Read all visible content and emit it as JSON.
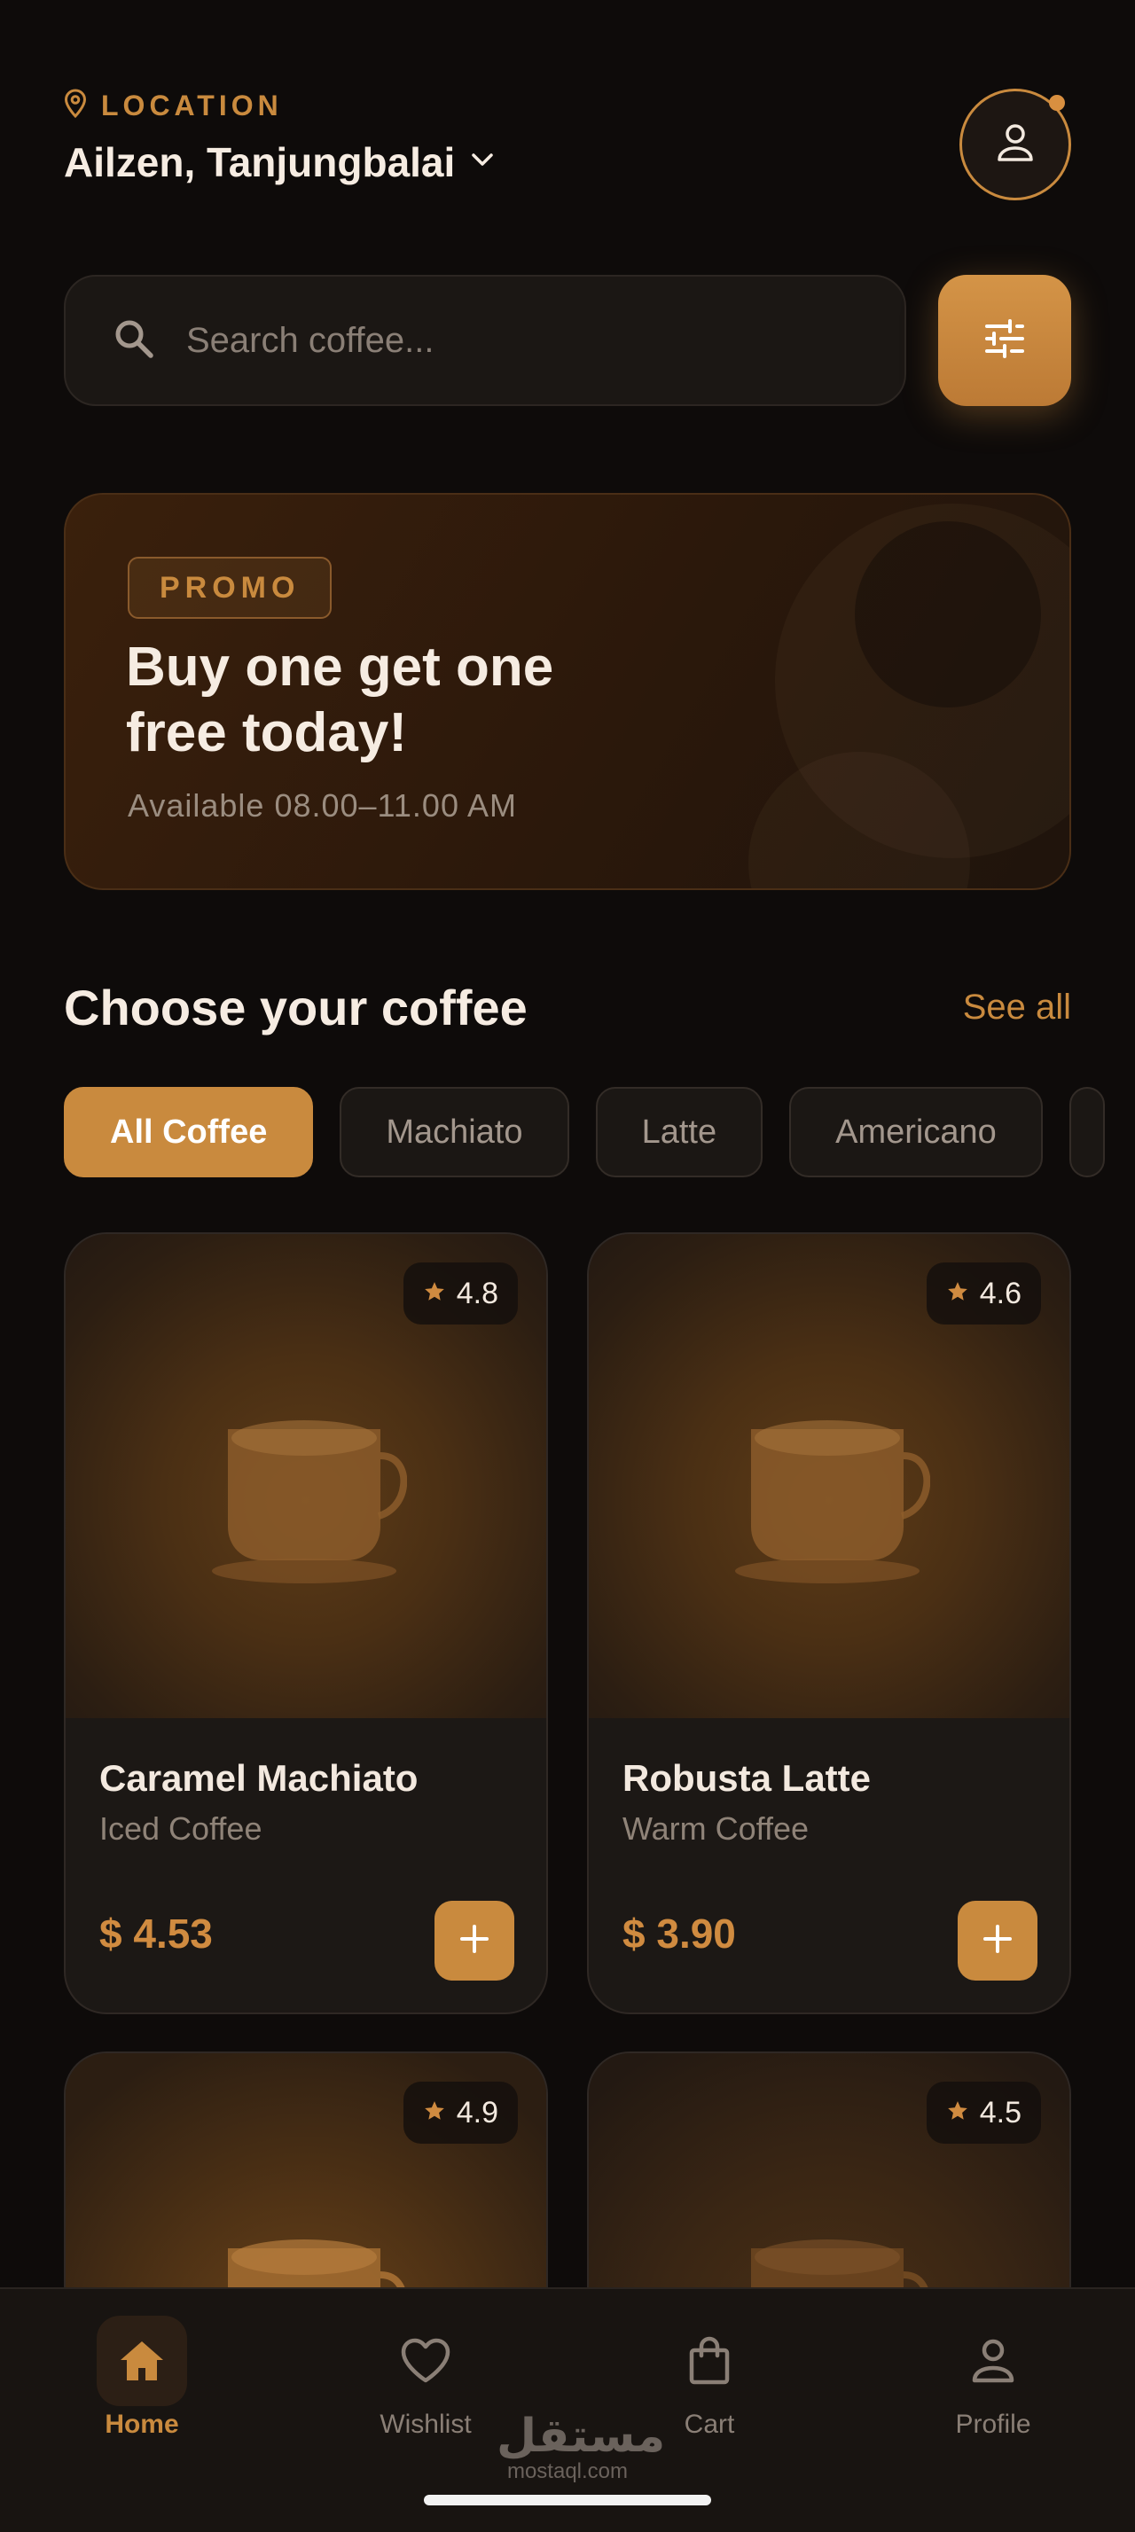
{
  "colors": {
    "accent": "#c98a3e",
    "background": "#0e0b0a",
    "surface": "#1c1815"
  },
  "header": {
    "location_label": "LOCATION",
    "location_value": "Ailzen, Tanjungbalai",
    "location_icon": "map-pin-icon",
    "dropdown_icon": "chevron-down-icon",
    "avatar_icon": "user-icon"
  },
  "search": {
    "placeholder": "Search coffee...",
    "value": "",
    "icon": "search-icon",
    "filter_icon": "sliders-icon"
  },
  "promo": {
    "badge": "PROMO",
    "title": "Buy one get one free today!",
    "subtitle": "Available 08.00–11.00 AM"
  },
  "section": {
    "title": "Choose your coffee",
    "see_all": "See all"
  },
  "categories": [
    "All Coffee",
    "Machiato",
    "Latte",
    "Americano"
  ],
  "products": [
    {
      "name": "Caramel Machiato",
      "type": "Iced Coffee",
      "price": "$ 4.53",
      "rating": "4.8"
    },
    {
      "name": "Robusta Latte",
      "type": "Warm Coffee",
      "price": "$ 3.90",
      "rating": "4.6"
    },
    {
      "rating": "4.9"
    },
    {
      "rating": "4.5"
    }
  ],
  "nav": [
    {
      "label": "Home",
      "icon": "home-icon"
    },
    {
      "label": "Wishlist",
      "icon": "heart-icon"
    },
    {
      "label": "Cart",
      "icon": "shopping-bag-icon"
    },
    {
      "label": "Profile",
      "icon": "user-icon"
    }
  ],
  "watermark": {
    "arabic": "مستقل",
    "latin": "mostaql.com"
  }
}
